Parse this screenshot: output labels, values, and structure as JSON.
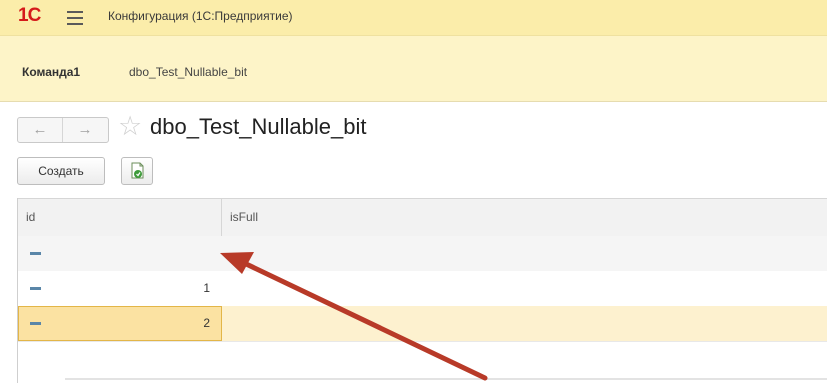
{
  "titlebar": {
    "logo": "1С",
    "title": "Конфигурация  (1С:Предприятие)"
  },
  "command_bar": {
    "items": [
      {
        "label": "Команда1"
      },
      {
        "label": "dbo_Test_Nullable_bit"
      }
    ]
  },
  "form": {
    "title": "dbo_Test_Nullable_bit",
    "nav": {
      "back": "←",
      "forward": "→"
    },
    "star_icon": "☆",
    "create_label": "Создать"
  },
  "table": {
    "columns": [
      "id",
      "isFull"
    ],
    "rows": [
      {
        "id": "",
        "isFull": ""
      },
      {
        "id": "1",
        "isFull": ""
      },
      {
        "id": "2",
        "isFull": ""
      }
    ]
  },
  "colors": {
    "titlebar": "#fbedaa",
    "command_bar": "#fdf4c8",
    "selected_row": "#fdf1cf",
    "selected_cell": "#fbe2a2",
    "annotation_arrow": "#b83a28"
  }
}
